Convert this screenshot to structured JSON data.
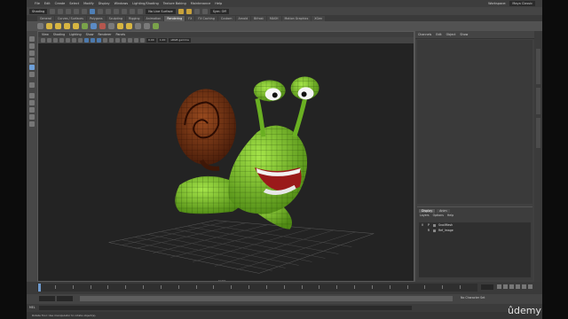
{
  "menubar": {
    "items": [
      "File",
      "Edit",
      "Create",
      "Select",
      "Modify",
      "Display",
      "Windows",
      "Lighting/Shading",
      "Texture Baking",
      "Maintenance",
      "Help"
    ],
    "workspace_label": "Workspace:",
    "workspace_value": "Maya Classic"
  },
  "status_line": {
    "menuset": "Shading",
    "live_surface": "No Live Surface",
    "symmetry": "Sym: Off"
  },
  "shelf": {
    "tabs": [
      "General",
      "Curves / Surfaces",
      "Polygons",
      "Sculpting",
      "Rigging",
      "Animation",
      "Rendering",
      "FX",
      "FX Caching",
      "Custom",
      "Arnold",
      "Bifrost",
      "MASH",
      "Motion Graphics",
      "XGen"
    ],
    "active_tab": "Rendering"
  },
  "viewport": {
    "menu": [
      "View",
      "Shading",
      "Lighting",
      "Show",
      "Renderer",
      "Panels"
    ],
    "gamma_field": "0.00",
    "exposure_field": "1.00",
    "colorspace": "sRGB gamma",
    "camera_label": "persp"
  },
  "channel_box": {
    "menu": [
      "Channels",
      "Edit",
      "Object",
      "Show"
    ]
  },
  "side_tabs": [
    "Channel Box / Layer Editor",
    "Modeling Toolkit",
    "Attribute Editor"
  ],
  "layer_editor": {
    "tabs": [
      "Display",
      "Anim"
    ],
    "active_tab": "Display",
    "menu": [
      "Layers",
      "Options",
      "Help"
    ],
    "layers": [
      {
        "v": "V",
        "p": "P",
        "name": "SnailMesh"
      },
      {
        "v": "",
        "p": "R",
        "name": "Ref_Image"
      }
    ]
  },
  "time_slider": {
    "current_frame": "1",
    "ticks": [
      "5",
      "10",
      "15",
      "20",
      "25",
      "30",
      "35",
      "40",
      "45",
      "50",
      "55",
      "60",
      "65",
      "70",
      "75",
      "80",
      "85",
      "90",
      "95",
      "100",
      "105",
      "110",
      "115",
      "120"
    ]
  },
  "range_slider": {
    "start": "1",
    "range_start": "1",
    "range_end": "120",
    "end": "120",
    "end2": "200",
    "character_set": "No Character Set",
    "anim_layer": "No Anim Layer"
  },
  "command_line": {
    "mel_label": "MEL"
  },
  "help_line": {
    "text": "Rotate Tool: Use manipulator to rotate object(s)."
  },
  "watermark": "ûdemy",
  "colors": {
    "snail_body": "#7dc52a",
    "shell": "#6a3013",
    "mouth": "#9a1a1a",
    "accent_blue": "#6d9fd8",
    "maya_logo": "#41c7c2"
  }
}
